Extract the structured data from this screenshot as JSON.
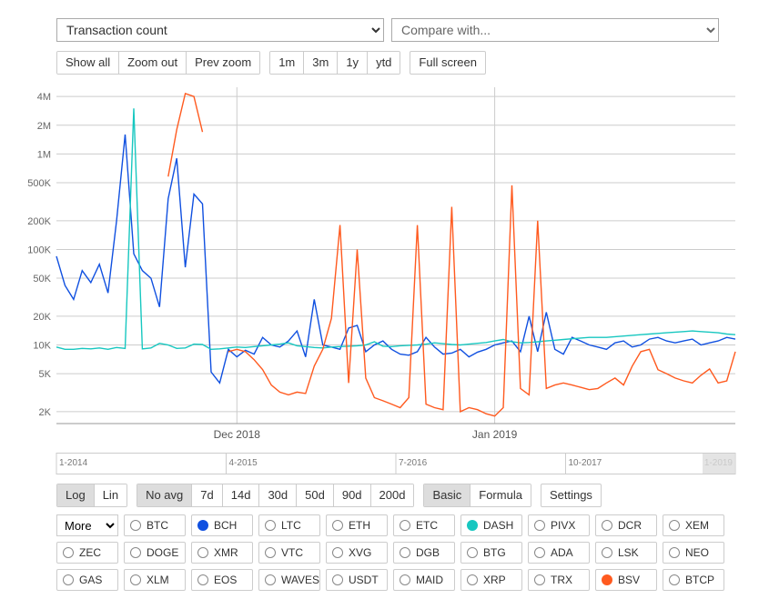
{
  "selectors": {
    "metric": "Transaction count",
    "compare": "Compare with..."
  },
  "toolbar": {
    "show_all": "Show all",
    "zoom_out": "Zoom out",
    "prev_zoom": "Prev zoom",
    "r1m": "1m",
    "r3m": "3m",
    "r1y": "1y",
    "rytd": "ytd",
    "full_screen": "Full screen"
  },
  "controls": {
    "log": "Log",
    "lin": "Lin",
    "noavg": "No avg",
    "a7": "7d",
    "a14": "14d",
    "a30": "30d",
    "a50": "50d",
    "a90": "90d",
    "a200": "200d",
    "basic": "Basic",
    "formula": "Formula",
    "settings": "Settings",
    "more": "More"
  },
  "brush": {
    "ticks": [
      "1-2014",
      "4-2015",
      "7-2016",
      "10-2017",
      "1-2019"
    ]
  },
  "coins": {
    "row1": [
      {
        "sym": "BTC",
        "on": false
      },
      {
        "sym": "BCH",
        "on": true,
        "color": "#1050E0"
      },
      {
        "sym": "LTC",
        "on": false
      },
      {
        "sym": "ETH",
        "on": false
      },
      {
        "sym": "ETC",
        "on": false
      },
      {
        "sym": "DASH",
        "on": true,
        "color": "#17C7C0"
      },
      {
        "sym": "PIVX",
        "on": false
      },
      {
        "sym": "DCR",
        "on": false
      },
      {
        "sym": "XEM",
        "on": false
      }
    ],
    "row2": [
      {
        "sym": "ZEC",
        "on": false
      },
      {
        "sym": "DOGE",
        "on": false
      },
      {
        "sym": "XMR",
        "on": false
      },
      {
        "sym": "VTC",
        "on": false
      },
      {
        "sym": "XVG",
        "on": false
      },
      {
        "sym": "DGB",
        "on": false
      },
      {
        "sym": "BTG",
        "on": false
      },
      {
        "sym": "ADA",
        "on": false
      },
      {
        "sym": "LSK",
        "on": false
      },
      {
        "sym": "NEO",
        "on": false
      }
    ],
    "row3": [
      {
        "sym": "GAS",
        "on": false
      },
      {
        "sym": "XLM",
        "on": false
      },
      {
        "sym": "EOS",
        "on": false
      },
      {
        "sym": "WAVES",
        "on": false
      },
      {
        "sym": "USDT",
        "on": false
      },
      {
        "sym": "MAID",
        "on": false
      },
      {
        "sym": "XRP",
        "on": false
      },
      {
        "sym": "TRX",
        "on": false
      },
      {
        "sym": "BSV",
        "on": true,
        "color": "#FF5A1F"
      },
      {
        "sym": "BTCP",
        "on": false
      }
    ]
  },
  "chart_data": {
    "type": "line",
    "title": "Transaction count",
    "xlabel": "",
    "ylabel": "",
    "y_scale": "log",
    "y_ticks": [
      2000,
      5000,
      10000,
      20000,
      50000,
      100000,
      200000,
      500000,
      1000000,
      2000000,
      4000000
    ],
    "y_tick_labels": [
      "2K",
      "5K",
      "10K",
      "20K",
      "50K",
      "100K",
      "200K",
      "500K",
      "1M",
      "2M",
      "4M"
    ],
    "ylim": [
      1500,
      5000000
    ],
    "x_ticks": [
      {
        "idx": 21,
        "label": "Dec 2018"
      },
      {
        "idx": 51,
        "label": "Jan 2019"
      }
    ],
    "n": 80,
    "series": [
      {
        "name": "BCH",
        "color": "#1050E0",
        "values": [
          85000,
          42000,
          30000,
          60000,
          45000,
          70000,
          35000,
          200000,
          1600000,
          90000,
          60000,
          50000,
          25000,
          340000,
          900000,
          65000,
          380000,
          300000,
          5200,
          4000,
          9000,
          7500,
          8800,
          8000,
          12000,
          10000,
          9500,
          11000,
          14000,
          7500,
          30000,
          10000,
          9500,
          9000,
          15000,
          16000,
          8500,
          10000,
          11000,
          9000,
          8000,
          7800,
          8500,
          12000,
          9500,
          8000,
          8200,
          9000,
          7500,
          8400,
          9000,
          10000,
          10500,
          11000,
          8500,
          20000,
          8500,
          22000,
          9000,
          8000,
          12000,
          11000,
          10000,
          9500,
          9000,
          10500,
          11000,
          9500,
          10000,
          11500,
          12000,
          11000,
          10500,
          11000,
          11500,
          10000,
          10500,
          11000,
          12000,
          11500
        ]
      },
      {
        "name": "DASH",
        "color": "#17C7C0",
        "values": [
          9500,
          9000,
          9000,
          9200,
          9100,
          9300,
          9000,
          9400,
          9200,
          3000000,
          9100,
          9300,
          10400,
          10000,
          9200,
          9300,
          10200,
          10100,
          9000,
          9100,
          9300,
          9500,
          9400,
          9600,
          9800,
          10000,
          10200,
          10500,
          9800,
          9600,
          9400,
          9300,
          9500,
          9600,
          9700,
          9800,
          10000,
          10800,
          9700,
          9600,
          9800,
          9900,
          10000,
          10200,
          10500,
          10300,
          10100,
          10000,
          10200,
          10400,
          10600,
          11000,
          11400,
          10800,
          10500,
          10600,
          10800,
          11000,
          11200,
          11400,
          11600,
          11800,
          12000,
          12000,
          12000,
          12200,
          12400,
          12600,
          12800,
          13000,
          13200,
          13400,
          13600,
          13800,
          14000,
          13800,
          13600,
          13400,
          13000,
          12800
        ]
      },
      {
        "name": "BSV",
        "color": "#FF5A1F",
        "values": [
          null,
          null,
          null,
          null,
          null,
          null,
          null,
          null,
          null,
          null,
          null,
          null,
          null,
          580000,
          1800000,
          4300000,
          4000000,
          1700000,
          null,
          null,
          8500,
          9000,
          8500,
          7000,
          5500,
          3800,
          3200,
          3000,
          3200,
          3100,
          6000,
          9000,
          19000,
          180000,
          4000,
          100000,
          4500,
          2800,
          2600,
          2400,
          2200,
          2800,
          180000,
          2400,
          2200,
          2100,
          280000,
          2000,
          2200,
          2100,
          1900,
          1800,
          2200,
          470000,
          3500,
          3000,
          200000,
          3500,
          3800,
          4000,
          3800,
          3600,
          3400,
          3500,
          4000,
          4500,
          3800,
          6000,
          8500,
          9000,
          5500,
          5000,
          4500,
          4200,
          4000,
          4800,
          5600,
          4000,
          4200,
          8500
        ]
      }
    ]
  }
}
